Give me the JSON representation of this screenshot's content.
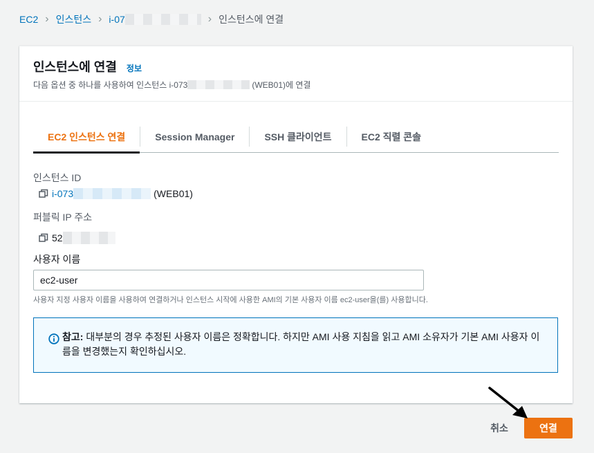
{
  "breadcrumb": {
    "items": [
      "EC2",
      "인스턴스",
      "i-07"
    ],
    "current": "인스턴스에 연결"
  },
  "panel": {
    "title": "인스턴스에 연결",
    "info_link": "정보",
    "desc_prefix": "다음 옵션 중 하나를 사용하여 인스턴스 i-073",
    "desc_suffix": "(WEB01)에 연결"
  },
  "tabs": [
    {
      "label": "EC2 인스턴스 연결",
      "active": true
    },
    {
      "label": "Session Manager",
      "active": false
    },
    {
      "label": "SSH 클라이언트",
      "active": false
    },
    {
      "label": "EC2 직렬 콘솔",
      "active": false
    }
  ],
  "instance": {
    "label": "인스턴스 ID",
    "id_prefix": "i-073",
    "name": "(WEB01)"
  },
  "public_ip": {
    "label": "퍼블릭 IP 주소",
    "value_prefix": "52"
  },
  "username": {
    "label": "사용자 이름",
    "value": "ec2-user",
    "hint": "사용자 지정 사용자 이름을 사용하여 연결하거나 인스턴스 시작에 사용한 AMI의 기본 사용자 이름 ec2-user을(를) 사용합니다."
  },
  "alert": {
    "strong": "참고:",
    "text": " 대부분의 경우 추정된 사용자 이름은 정확합니다. 하지만 AMI 사용 지침을 읽고 AMI 소유자가 기본 AMI 사용자 이름을 변경했는지 확인하십시오."
  },
  "actions": {
    "cancel": "취소",
    "connect": "연결"
  },
  "colors": {
    "accent": "#ec7211",
    "link": "#0073bb",
    "info_border": "#0073bb"
  }
}
